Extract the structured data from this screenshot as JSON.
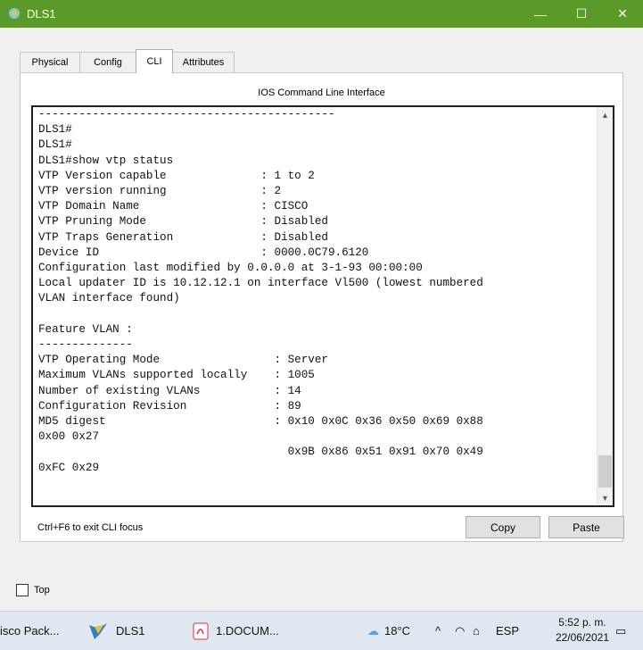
{
  "window": {
    "title": "DLS1",
    "minimize": "—",
    "maximize": "☐",
    "close": "✕"
  },
  "tabs": [
    "Physical",
    "Config",
    "CLI",
    "Attributes"
  ],
  "active_tab": "CLI",
  "panel_title": "IOS Command Line Interface",
  "cli_output": "--------------------------------------------\nDLS1#\nDLS1#\nDLS1#show vtp status\nVTP Version capable              : 1 to 2\nVTP version running              : 2\nVTP Domain Name                  : CISCO\nVTP Pruning Mode                 : Disabled\nVTP Traps Generation             : Disabled\nDevice ID                        : 0000.0C79.6120\nConfiguration last modified by 0.0.0.0 at 3-1-93 00:00:00\nLocal updater ID is 10.12.12.1 on interface Vl500 (lowest numbered\nVLAN interface found)\n\nFeature VLAN :\n--------------\nVTP Operating Mode                 : Server\nMaximum VLANs supported locally    : 1005\nNumber of existing VLANs           : 14\nConfiguration Revision             : 89\nMD5 digest                         : 0x10 0x0C 0x36 0x50 0x69 0x88\n0x00 0x27\n                                     0x9B 0x86 0x51 0x91 0x70 0x49\n0xFC 0x29",
  "hint": "Ctrl+F6 to exit CLI focus",
  "buttons": {
    "copy": "Copy",
    "paste": "Paste"
  },
  "top_checkbox_label": "Top",
  "taskbar": {
    "items": [
      "isco Pack...",
      "DLS1",
      "1.DOCUM..."
    ],
    "weather": "18°C",
    "tray_up": "^",
    "language": "ESP",
    "time": "5:52 p. m.",
    "date": "22/06/2021"
  },
  "colors": {
    "titlebar": "#5a9a28",
    "taskbar": "#dfe7f0"
  }
}
